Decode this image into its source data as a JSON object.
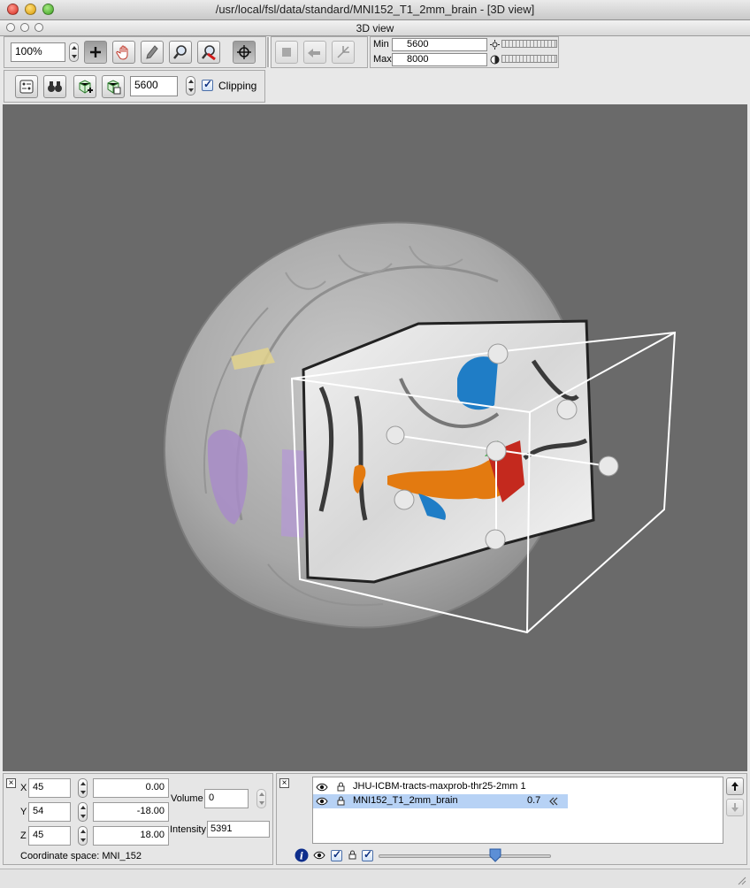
{
  "window": {
    "title": "/usr/local/fsl/data/standard/MNI152_T1_2mm_brain - [3D view]"
  },
  "frame": {
    "title": "3D view"
  },
  "toolbar1": {
    "zoom_value": "100%",
    "tools": [
      "crosshair-tool",
      "pan-tool",
      "pencil-tool",
      "zoom-tool",
      "zoom-out-tool",
      "cursor-center-tool"
    ],
    "nav_tools": [
      "stop-tool",
      "rotate-tool",
      "axes-tool"
    ]
  },
  "display_range": {
    "min_label": "Min",
    "min_value": "5600",
    "max_label": "Max",
    "max_value": "8000"
  },
  "toolbar2": {
    "threshold_value": "5600",
    "clipping_label": "Clipping",
    "clipping_checked": true
  },
  "cursor_panel": {
    "x_label": "X",
    "x_voxel": "45",
    "x_world": "0.00",
    "y_label": "Y",
    "y_voxel": "54",
    "y_world": "-18.00",
    "z_label": "Z",
    "z_voxel": "45",
    "z_world": "18.00",
    "volume_label": "Volume",
    "volume_value": "0",
    "intensity_label": "Intensity",
    "intensity_value": "5391",
    "coord_space": "Coordinate space: MNI_152"
  },
  "layers": [
    {
      "name": "JHU-ICBM-tracts-maxprob-thr25-2mm 1",
      "opacity": "",
      "selected": false
    },
    {
      "name": "MNI152_T1_2mm_brain",
      "opacity": "0.7",
      "selected": true
    }
  ],
  "colors": {
    "viewport_bg": "#6a6a6a",
    "selection": "#b7d2f5",
    "accent": "#1e5fc2"
  }
}
